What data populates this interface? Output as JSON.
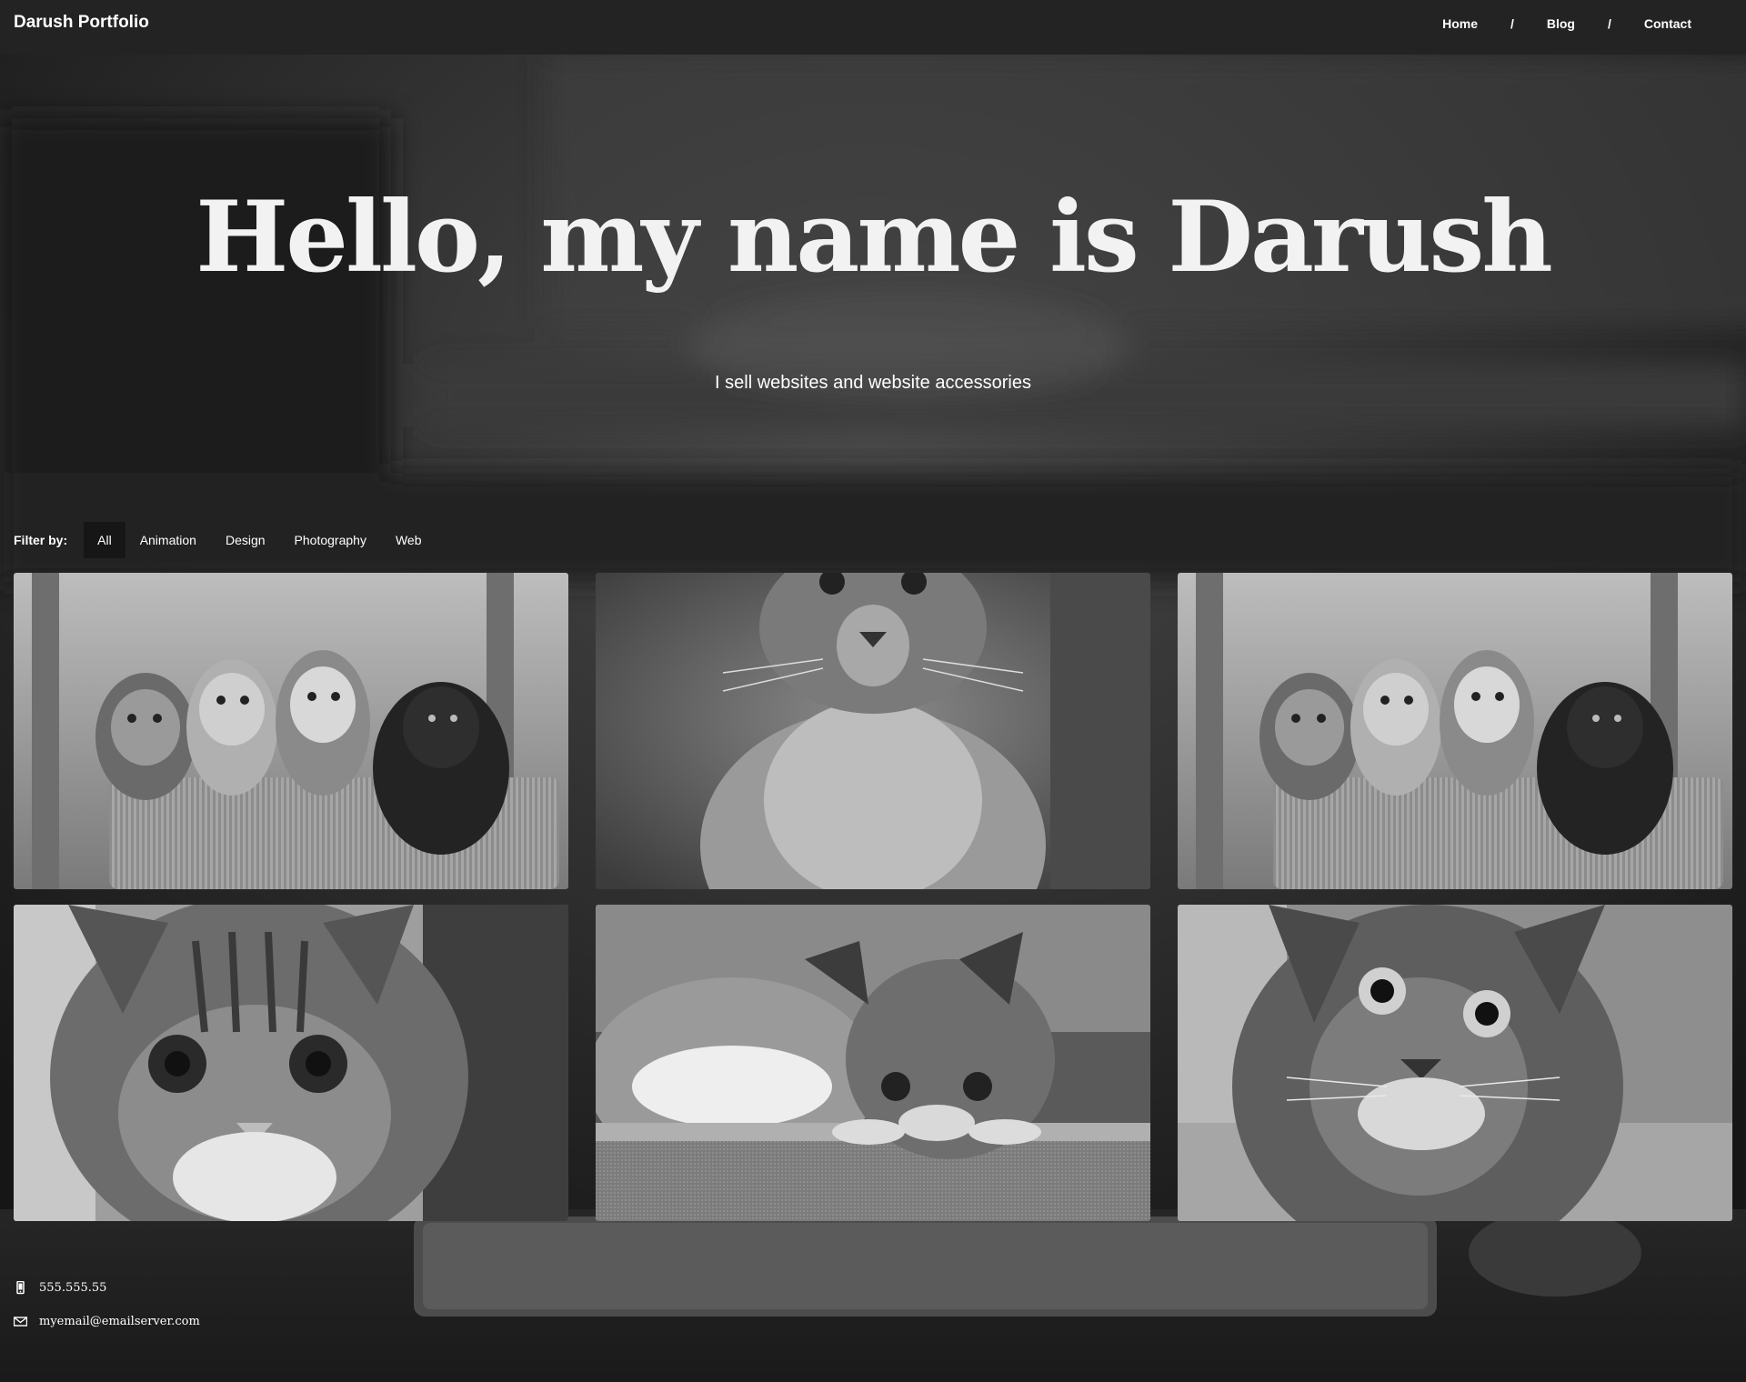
{
  "navbar": {
    "brand": "Darush Portfolio",
    "links": [
      {
        "label": "Home"
      },
      {
        "label": "Blog"
      },
      {
        "label": "Contact"
      }
    ],
    "separator": "/"
  },
  "hero": {
    "title": "Hello, my name is Darush",
    "subtitle": "I sell websites and website accessories"
  },
  "filter": {
    "label": "Filter by:",
    "options": [
      "All",
      "Animation",
      "Design",
      "Photography",
      "Web"
    ],
    "active": "All"
  },
  "gallery": {
    "items": [
      {
        "subject": "four-kittens-in-basket-photo"
      },
      {
        "subject": "kitten-looking-up-photo"
      },
      {
        "subject": "four-kittens-in-basket-photo"
      },
      {
        "subject": "tabby-kitten-closeup-photo"
      },
      {
        "subject": "kitten-on-table-photo"
      },
      {
        "subject": "kitten-portrait-photo"
      }
    ]
  },
  "footer": {
    "phone": "555.555.55",
    "email": "myemail@emailserver.com",
    "phone_icon": "mobile-phone-icon",
    "email_icon": "envelope-icon"
  },
  "colors": {
    "navbar_bg": "#232323",
    "active_filter_bg": "#161616",
    "text": "#ffffff"
  }
}
